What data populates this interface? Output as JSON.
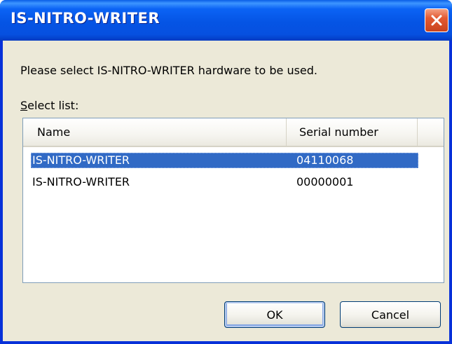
{
  "window": {
    "title": "IS-NITRO-WRITER"
  },
  "dialog": {
    "message": "Please select IS-NITRO-WRITER hardware to be used.",
    "select_label_accel": "S",
    "select_label_rest": "elect list:"
  },
  "list": {
    "columns": {
      "name": "Name",
      "serial": "Serial number"
    },
    "rows": [
      {
        "name": "IS-NITRO-WRITER",
        "serial": "04110068",
        "selected": true
      },
      {
        "name": "IS-NITRO-WRITER",
        "serial": "00000001",
        "selected": false
      }
    ]
  },
  "buttons": {
    "ok": "OK",
    "cancel": "Cancel"
  },
  "colors": {
    "titlebar": "#0554e4",
    "selection": "#316ac5",
    "dialog_bg": "#ece9d8",
    "close_button": "#e35a32"
  }
}
